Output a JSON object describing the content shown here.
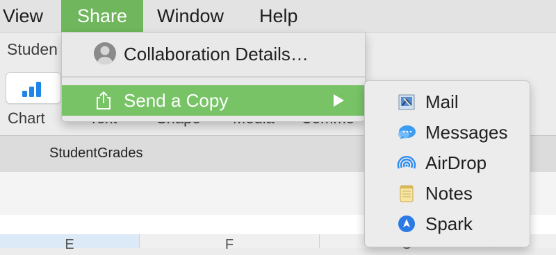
{
  "menubar": {
    "items": [
      "View",
      "Share",
      "Window",
      "Help"
    ],
    "active": "Share",
    "accent": "#6fb65c"
  },
  "window": {
    "doc_title": "Studen",
    "toolbar": {
      "chart": "Chart",
      "text": "Text",
      "shape": "Shape",
      "media": "Media",
      "comment": "Comme"
    },
    "sheet_tab": "StudentGrades",
    "columns": [
      "E",
      "F",
      "G"
    ]
  },
  "share_menu": {
    "collaboration": {
      "label": "Collaboration Details…",
      "icon": "person-avatar-icon"
    },
    "send_copy": {
      "label": "Send a Copy",
      "icon": "share-arrow-icon",
      "highlight": "#77c366"
    }
  },
  "send_submenu": [
    {
      "label": "Mail",
      "icon": "mail-icon"
    },
    {
      "label": "Messages",
      "icon": "messages-icon"
    },
    {
      "label": "AirDrop",
      "icon": "airdrop-icon"
    },
    {
      "label": "Notes",
      "icon": "notes-icon"
    },
    {
      "label": "Spark",
      "icon": "spark-icon"
    }
  ]
}
